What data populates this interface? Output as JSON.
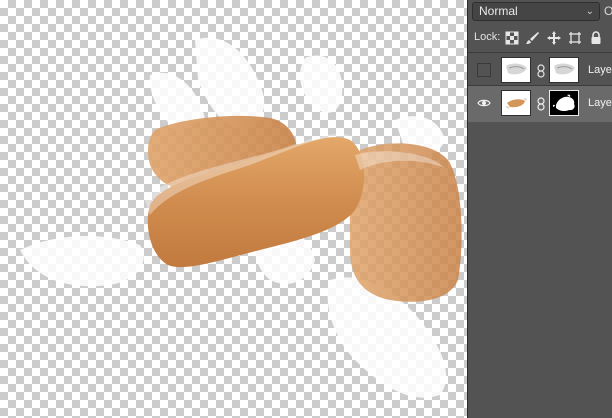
{
  "canvas": {
    "description_icon": "caramel-candies-image"
  },
  "layers_panel": {
    "blend_mode": "Normal",
    "opacity_label": "O",
    "lock_label": "Lock:",
    "lock_icons": [
      "lock-transparent-icon",
      "lock-paint-icon",
      "lock-position-icon",
      "lock-artboard-icon",
      "lock-all-icon"
    ],
    "layers": [
      {
        "name": "Laye",
        "visible": false,
        "selected": false
      },
      {
        "name": "Laye",
        "visible": true,
        "selected": true
      }
    ]
  },
  "colors": {
    "panel_bg": "#535353",
    "selected_row": "#6a6a6a",
    "caramel": "#d4955a"
  }
}
